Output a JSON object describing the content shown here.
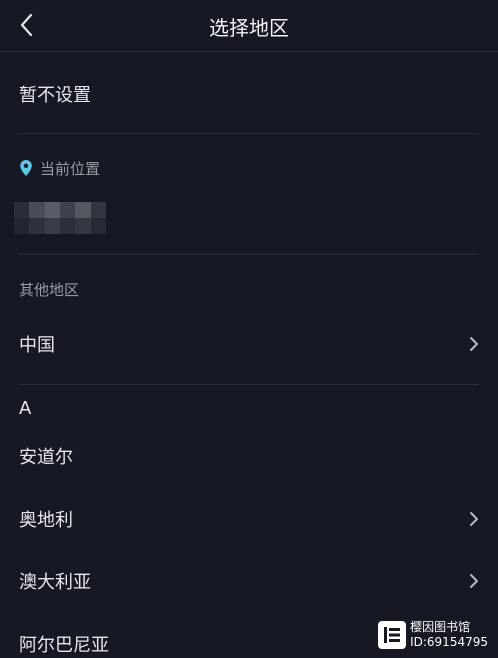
{
  "header": {
    "title": "选择地区",
    "back_icon": "chevron-left-icon"
  },
  "not_set": {
    "label": "暂不设置"
  },
  "current_location": {
    "caption": "当前位置",
    "icon": "location-pin-icon",
    "pin_color": "#5fc6e6"
  },
  "other_regions": {
    "caption": "其他地区"
  },
  "regions": [
    {
      "label": "中国",
      "has_arrow": true
    }
  ],
  "letter_sections": [
    {
      "letter": "A",
      "items": [
        {
          "label": "安道尔",
          "has_arrow": false
        },
        {
          "label": "奥地利",
          "has_arrow": true
        },
        {
          "label": "澳大利亚",
          "has_arrow": true
        },
        {
          "label": "阿尔巴尼亚",
          "has_arrow": false
        }
      ]
    }
  ],
  "watermark": {
    "line1": "樱因图书馆",
    "line2": "ID:69154795"
  },
  "colors": {
    "background": "#161823",
    "divider": "#2a2c37",
    "text": "#e8e8ea",
    "caption": "#9a9ba3"
  }
}
